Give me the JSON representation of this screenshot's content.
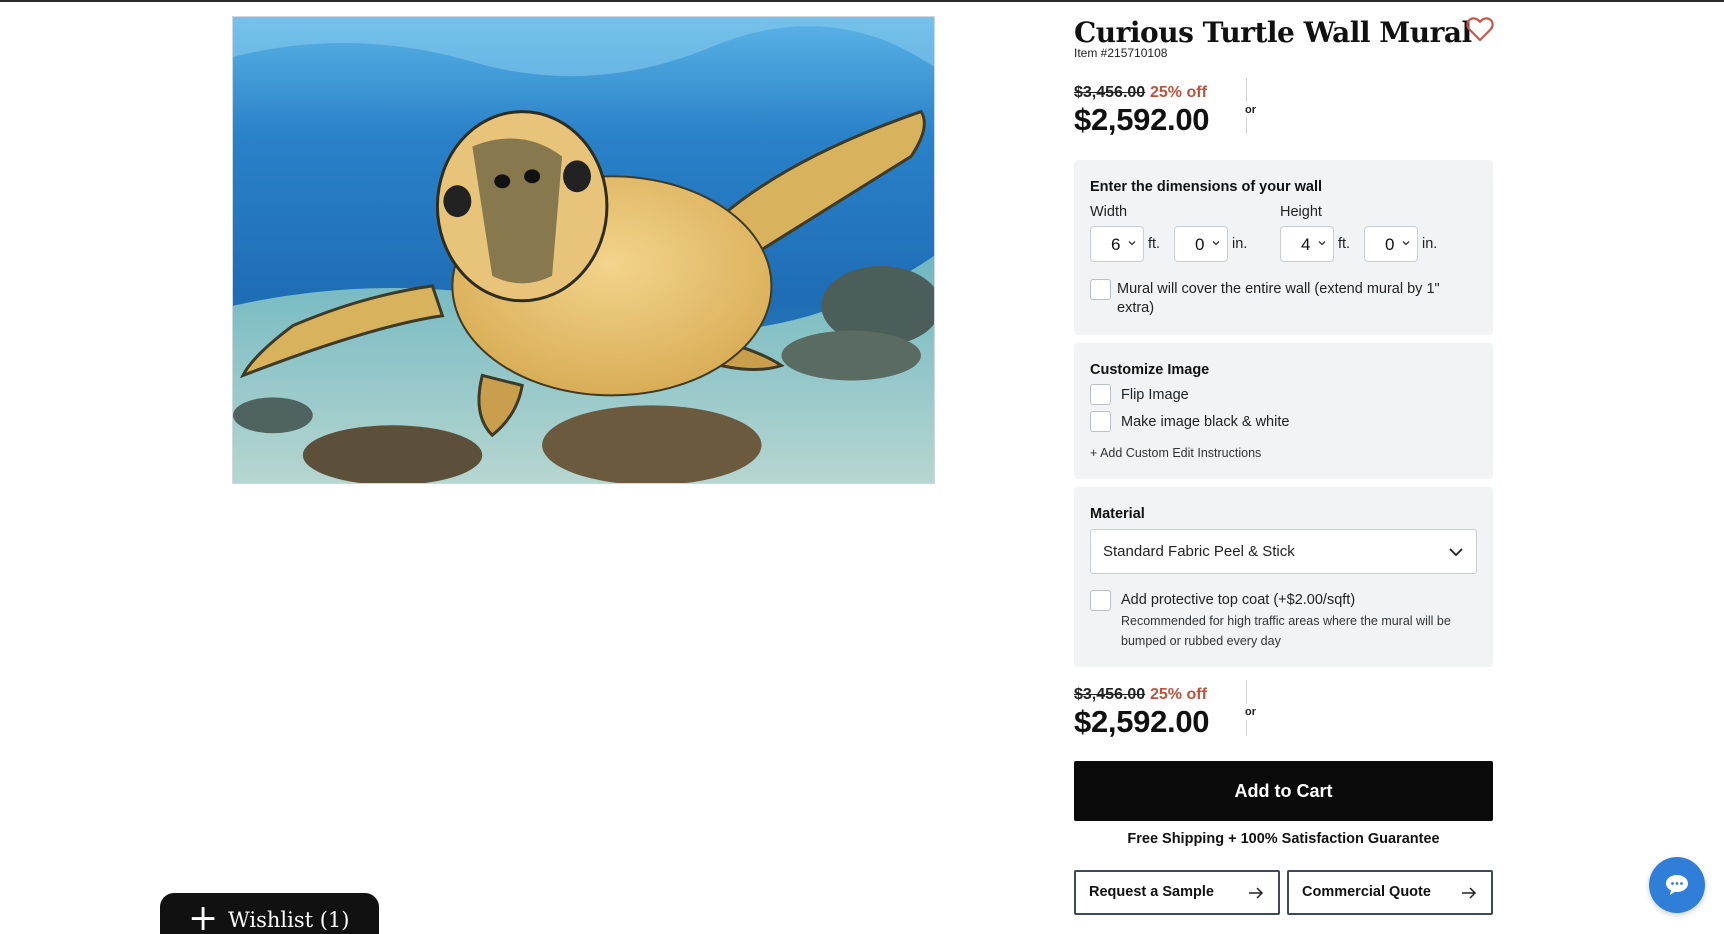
{
  "product": {
    "title": "Curious Turtle Wall Mural",
    "item_number": "Item #215710108",
    "image_alt": "sea turtle underwater"
  },
  "price_top": {
    "original": "$3,456.00",
    "discount": "25% off",
    "current": "$2,592.00",
    "or_label": "or"
  },
  "dimensions": {
    "title": "Enter the dimensions of your wall",
    "width_label": "Width",
    "height_label": "Height",
    "width_ft": "6",
    "width_in": "0",
    "height_ft": "4",
    "height_in": "0",
    "ft_unit": "ft.",
    "in_unit": "in.",
    "cover_line1": "Mural will cover the entire wall (extend mural by 1\"",
    "cover_line2": "extra)"
  },
  "customize": {
    "title": "Customize Image",
    "flip_label": "Flip Image",
    "bw_label": "Make image black & white",
    "custom_edit": "+  Add Custom Edit Instructions"
  },
  "material": {
    "title": "Material",
    "selected": "Standard Fabric Peel & Stick",
    "topcoat_label": "Add protective top coat (+$2.00/sqft)",
    "topcoat_note_line1": "Recommended for high traffic areas where the mural will be",
    "topcoat_note_line2": "bumped or rubbed every day"
  },
  "price_bottom": {
    "original": "$3,456.00",
    "discount": "25% off",
    "current": "$2,592.00",
    "or_label": "or"
  },
  "actions": {
    "add_to_cart": "Add to Cart",
    "shipping_note": "Free Shipping + 100% Satisfaction Guarantee",
    "request_sample": "Request a Sample",
    "commercial_quote": "Commercial Quote"
  },
  "wishlist": {
    "label": "Wishlist (1)"
  },
  "icons": {
    "favorite": "heart-icon",
    "chat": "chat-bubble-icon",
    "arrow": "arrow-right-icon",
    "chevron": "chevron-down-icon",
    "plus": "plus-icon"
  },
  "colors": {
    "discount": "#c0513c",
    "heart": "#c7574a",
    "button": "#0a0a0a",
    "panel": "#f1f3f5",
    "chat": "#2f7ed8"
  }
}
